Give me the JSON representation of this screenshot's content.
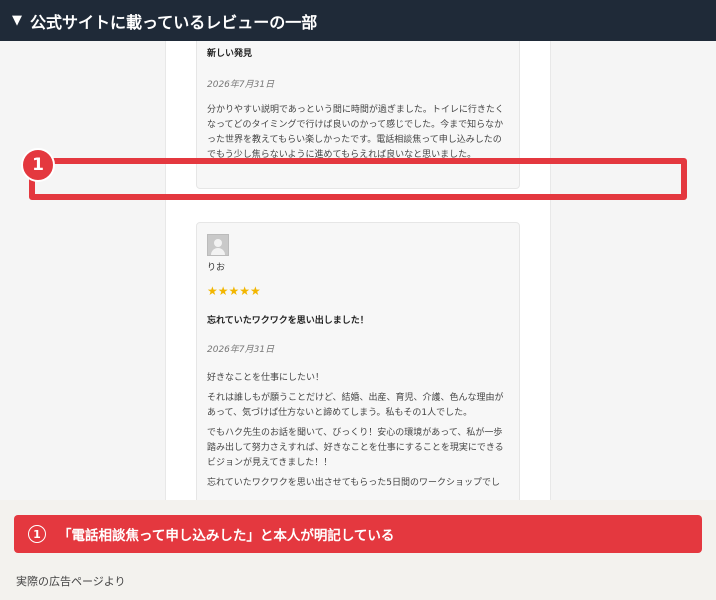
{
  "header": {
    "arrow": "▼",
    "title": "公式サイトに載っているレビューの一部"
  },
  "reviews": [
    {
      "title": "新しい発見",
      "date": "2026年7月31日",
      "body": [
        "分かりやすい説明であっという間に時間が過ぎました。トイレに行きたくなってどのタイミングで行けば良いのかって感じでした。今まで知らなかった世界を教えてもらい楽しかったです。電話相談焦って申し込みしたのでもう少し焦らないように進めてもらえれば良いなと思いました。"
      ]
    },
    {
      "name": "りお",
      "stars": "★★★★★",
      "rating": 5,
      "title": "忘れていたワクワクを思い出しました！",
      "date": "2026年7月31日",
      "body": [
        "好きなことを仕事にしたい！",
        "それは誰しもが願うことだけど、結婚、出産、育児、介護、色んな理由があって、気づけば仕方ないと諦めてしまう。私もその1人でした。",
        "でもハク先生のお話を聞いて、びっくり！安心の環境があって、私が一歩踏み出して努力さえすれば、好きなことを仕事にすることを現実にできるビジョンが見えてきました！！",
        "忘れていたワクワクを思い出させてもらった5日間のワークショップでし"
      ]
    }
  ],
  "annotation": {
    "badge": "1",
    "accent_color": "#e4383f"
  },
  "note": {
    "num": "①",
    "text": "「電話相談焦って申し込みした」と本人が明記している"
  },
  "source": "実際の広告ページより"
}
